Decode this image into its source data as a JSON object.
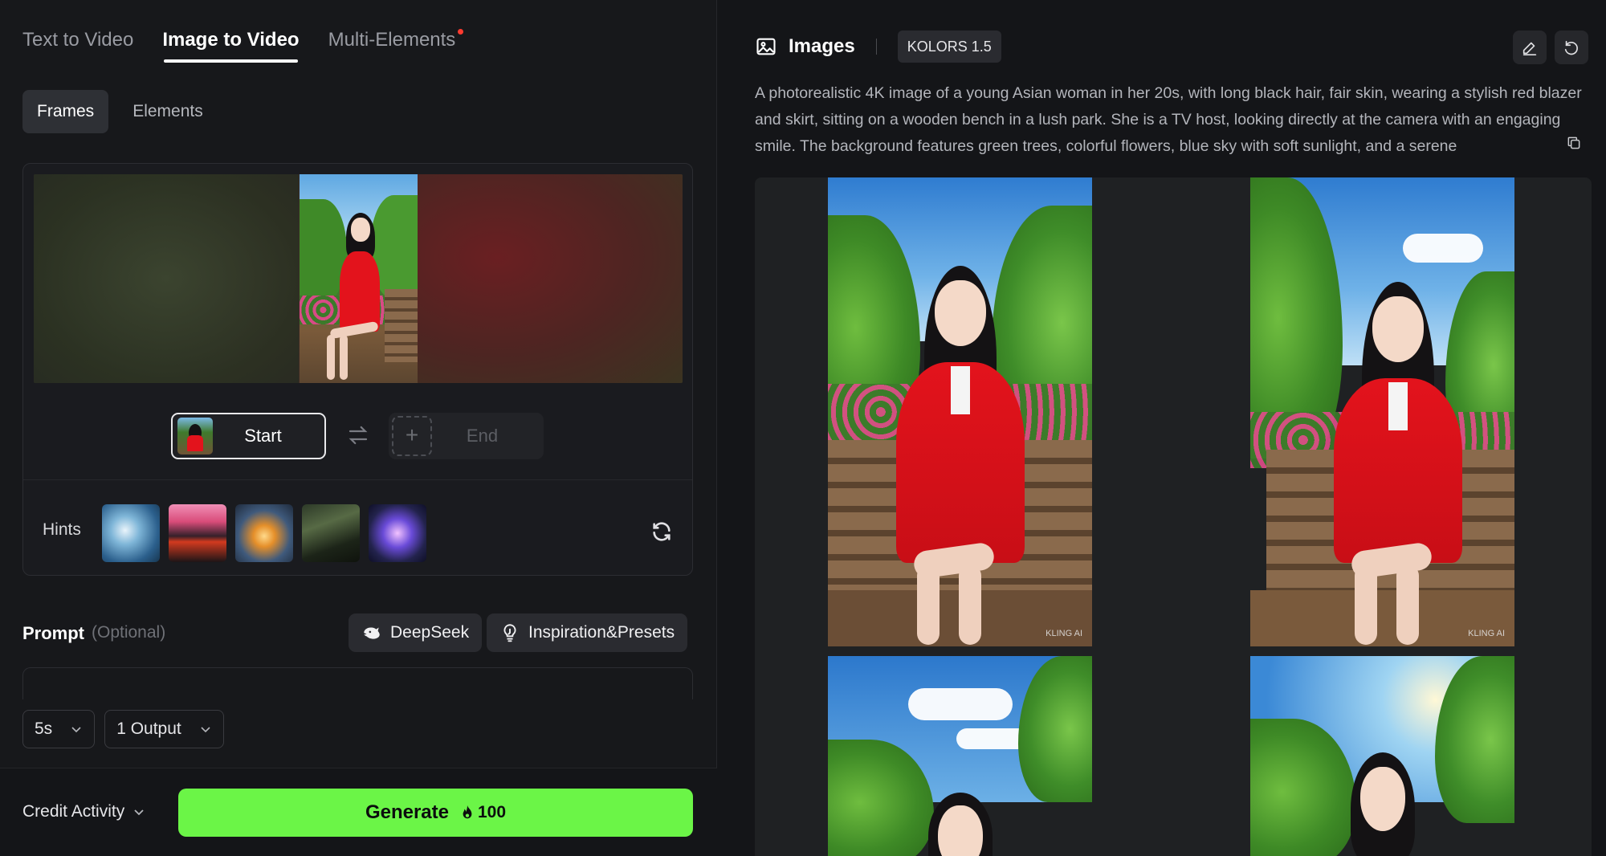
{
  "mode_tabs": [
    {
      "label": "Text to Video",
      "active": false
    },
    {
      "label": "Image to Video",
      "active": true
    },
    {
      "label": "Multi-Elements",
      "active": false,
      "has_dot": true
    }
  ],
  "sub_tabs": [
    {
      "label": "Frames",
      "active": true
    },
    {
      "label": "Elements",
      "active": false
    }
  ],
  "frames": {
    "start_label": "Start",
    "end_label": "End",
    "end_placeholder": "+"
  },
  "hints": {
    "label": "Hints",
    "count": 5
  },
  "prompt": {
    "title": "Prompt",
    "optional": "(Optional)",
    "deepseek_label": "DeepSeek",
    "inspiration_label": "Inspiration&Presets"
  },
  "options": {
    "duration": "5s",
    "outputs": "1 Output"
  },
  "footer": {
    "credit_label": "Credit Activity",
    "generate_label": "Generate",
    "generate_cost": "100",
    "generate_color": "#6bf547"
  },
  "right_panel": {
    "title": "Images",
    "model": "KOLORS 1.5",
    "description": "A photorealistic 4K image of a young Asian woman in her 20s, with long black hair, fair skin, wearing a stylish red blazer and skirt, sitting on a wooden bench in a lush park. She is a TV host, looking directly at the camera with an engaging smile. The background features green trees, colorful flowers, blue sky with soft sunlight, and a serene",
    "watermark": "KLING AI"
  },
  "icons": {
    "images": "image-icon",
    "edit": "pencil-icon",
    "undo": "undo-icon",
    "copy": "copy-icon",
    "swap": "swap-icon",
    "refresh": "refresh-icon",
    "deepseek": "whale-icon",
    "inspiration": "lightbulb-icon",
    "flame": "flame-icon"
  }
}
